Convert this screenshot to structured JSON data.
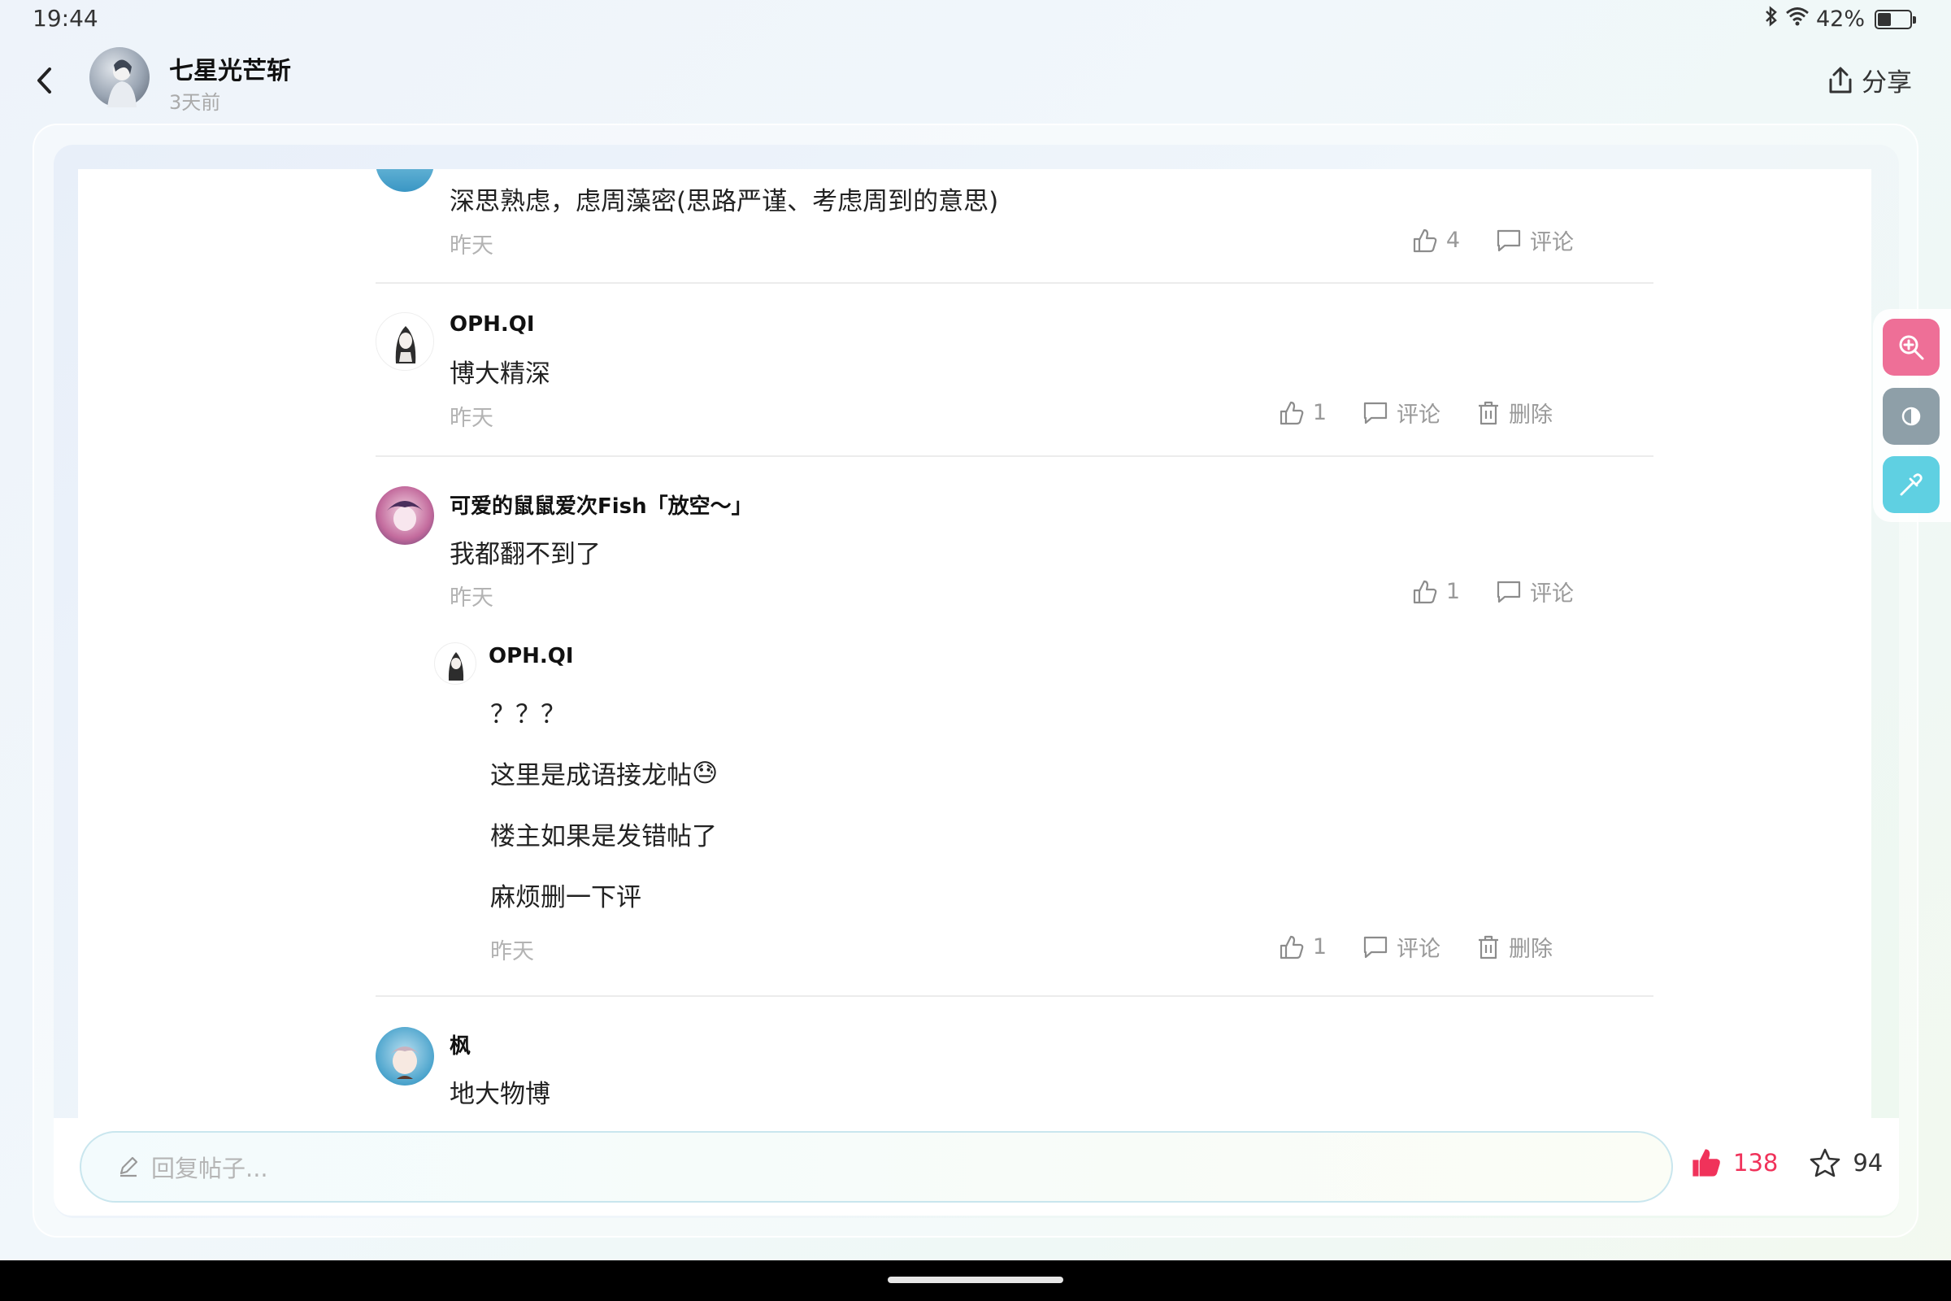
{
  "status": {
    "time": "19:44",
    "battery": "42%",
    "battery_level": 0.42
  },
  "post_header": {
    "author": "七星光芒斩",
    "time": "3天前",
    "share_label": "分享"
  },
  "comments": [
    {
      "text": "深思熟虑，虑周藻密(思路严谨、考虑周到的意思)",
      "time": "昨天",
      "likes": "4",
      "comment_label": "评论"
    },
    {
      "user": "OPH.QI",
      "text": "博大精深",
      "time": "昨天",
      "likes": "1",
      "comment_label": "评论",
      "delete_label": "删除"
    },
    {
      "user": "可爱的鼠鼠爱次Fish「放空～」",
      "text": "我都翻不到了",
      "time": "昨天",
      "likes": "1",
      "comment_label": "评论",
      "reply": {
        "user": "OPH.QI",
        "lines": [
          "？？？",
          "这里是成语接龙帖",
          "楼主如果是发错帖了",
          "麻烦删一下评"
        ],
        "emoji": "😓",
        "time": "昨天",
        "likes": "1",
        "comment_label": "评论",
        "delete_label": "删除"
      }
    },
    {
      "user": "枫",
      "text": "地大物博"
    }
  ],
  "bottom": {
    "reply_placeholder": "回复帖子...",
    "like_count": "138",
    "star_count": "94"
  },
  "colors": {
    "like_active": "#f0325a",
    "float_search": "#ee6f97",
    "float_contrast": "#8e9fa8",
    "float_picker": "#5fd0e2"
  }
}
